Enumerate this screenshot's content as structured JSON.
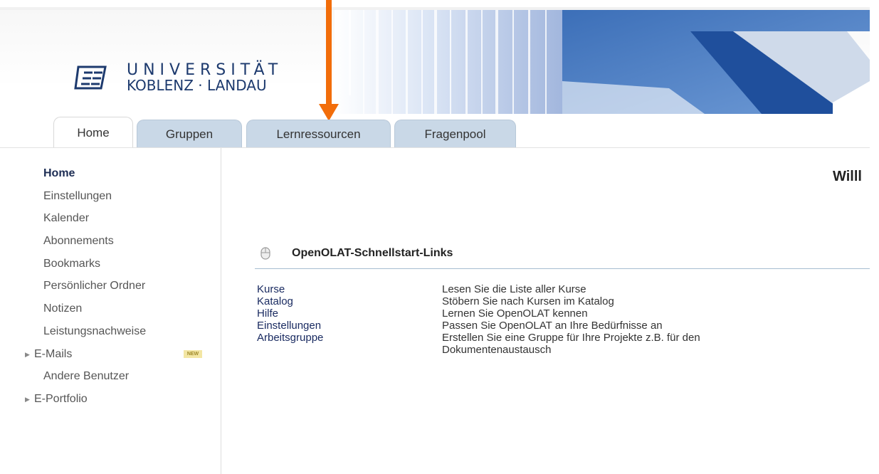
{
  "header": {
    "logo_line1": "UNIVERSITÄT",
    "logo_line2": "KOBLENZ · LANDAU",
    "banner_colors": [
      "#6f8bc2",
      "#dbe5f5",
      "#1f4f9c",
      "#ffffff"
    ],
    "arrow_color": "#f26d0a"
  },
  "tabs": [
    {
      "label": "Home",
      "active": true
    },
    {
      "label": "Gruppen",
      "active": false
    },
    {
      "label": "Lernressourcen",
      "active": false
    },
    {
      "label": "Fragenpool",
      "active": false
    }
  ],
  "sidebar": {
    "items": [
      {
        "label": "Home",
        "active": true
      },
      {
        "label": "Einstellungen"
      },
      {
        "label": "Kalender"
      },
      {
        "label": "Abonnements"
      },
      {
        "label": "Bookmarks"
      },
      {
        "label": "Persönlicher Ordner"
      },
      {
        "label": "Notizen"
      },
      {
        "label": "Leistungsnachweise"
      },
      {
        "label": "E-Mails",
        "expandable": true,
        "badge": "NEW"
      },
      {
        "label": "Andere Benutzer"
      },
      {
        "label": "E-Portfolio",
        "expandable": true
      }
    ]
  },
  "main": {
    "welcome": "Willl",
    "quickstart": {
      "title": "OpenOLAT-Schnellstart-Links",
      "links": [
        {
          "label": "Kurse",
          "description": "Lesen Sie die Liste aller Kurse"
        },
        {
          "label": "Katalog",
          "description": "Stöbern Sie nach Kursen im Katalog"
        },
        {
          "label": "Hilfe",
          "description": "Lernen Sie OpenOLAT kennen"
        },
        {
          "label": "Einstellungen",
          "description": "Passen Sie OpenOLAT an Ihre Bedürfnisse an"
        },
        {
          "label": "Arbeitsgruppe",
          "description_line1": "Erstellen Sie eine Gruppe für Ihre Projekte z.B. für den",
          "description_line2": "Dokumentenaustausch"
        }
      ]
    }
  }
}
